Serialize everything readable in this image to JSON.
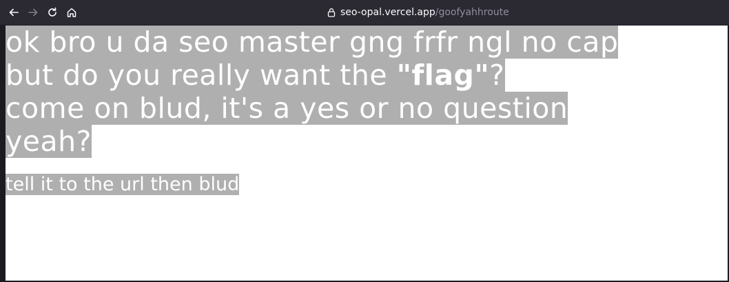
{
  "browser": {
    "url_host": "seo-opal.vercel.app",
    "url_path": "/goofyahhroute"
  },
  "page": {
    "line1": "ok bro u da seo master gng frfr ngl no cap",
    "line2_pre": "but do you really want the ",
    "line2_bold": "\"flag\"",
    "line2_post": "?",
    "line3": "come on blud, it's a yes or no question",
    "line4": "yeah?",
    "sub": "tell it to the url then blud"
  },
  "colors": {
    "toolbar": "#2b2a33",
    "selection": "#afafaf",
    "text": "#ffffff"
  }
}
